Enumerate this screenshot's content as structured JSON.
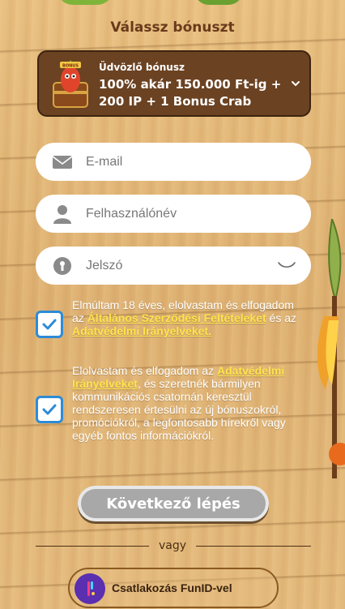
{
  "page": {
    "title": "Válassz bónuszt"
  },
  "bonus": {
    "label": "Üdvözlő bónusz",
    "text": "100% akár 150.000 Ft-ig + 200 IP + 1 Bonus Crab"
  },
  "fields": {
    "email_placeholder": "E-mail",
    "username_placeholder": "Felhasználónév",
    "password_placeholder": "Jelszó"
  },
  "consent1": {
    "part1": "Elmúltam 18 éves, elolvastam és elfogadom az ",
    "link1": "Általános Szerződési Feltételeket",
    "part2": " és az ",
    "link2": "Adatvédelmi Irányelveket.",
    "checked": true
  },
  "consent2": {
    "part1": "Elolvastam és elfogadom az ",
    "link1": "Adatvédelmi Irányelveket",
    "part2": ", és szeretnék bármilyen kommunikációs csatornán keresztül rendszeresen értesülni az új bónuszokról, promóciókról, a legfontosabb hírekről vagy egyéb fontos információkról.",
    "checked": true
  },
  "actions": {
    "next_label": "Következő lépés",
    "or_label": "vagy",
    "funid_label": "Csatlakozás FunID-vel"
  },
  "icons": {
    "email": "mail-icon",
    "user": "user-icon",
    "lock": "lock-icon",
    "eye": "eye-closed-icon",
    "chevron": "chevron-down-icon",
    "funid": "funid-logo-icon"
  },
  "colors": {
    "accent_link": "#ffe44a",
    "checkbox_border": "#2e8bd6",
    "bonus_bg": "#6b4222",
    "button_disabled": "#a8a8a8"
  }
}
